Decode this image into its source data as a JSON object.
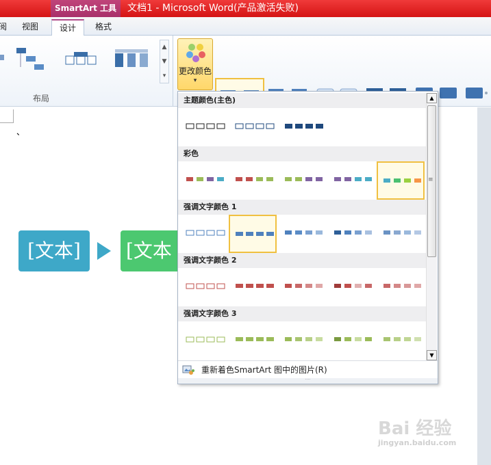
{
  "titlebar": {
    "tools_tab": "SmartArt 工具",
    "doc_title": "文档1 - Microsoft Word(产品激活失败)"
  },
  "tabs": [
    {
      "label": "阅"
    },
    {
      "label": "视图"
    },
    {
      "label": "设计"
    },
    {
      "label": "格式"
    }
  ],
  "ribbon": {
    "layout_group_label": "布局",
    "change_color_label": "更改颜色",
    "dropdown_arrow": "▾"
  },
  "dropdown": {
    "sections": [
      {
        "title": "主题颜色(主色)"
      },
      {
        "title": "彩色"
      },
      {
        "title": "强调文字颜色 1"
      },
      {
        "title": "强调文字颜色 2"
      },
      {
        "title": "强调文字颜色 3"
      }
    ],
    "recolor_label": "重新着色SmartArt 图中的图片(R)",
    "resize_grip": "····"
  },
  "document": {
    "box1_text": "[文本]",
    "box2_text": "[文本",
    "tick": "、"
  },
  "colors": {
    "accent1": "#4f81bd",
    "accent2": "#c0504d",
    "accent3": "#9bbb59",
    "accent4": "#8064a2",
    "accent5": "#4bacc6",
    "accent6": "#f79646",
    "dark": "#1f497d",
    "box1": "#3ea8c8",
    "box2": "#4cc870"
  },
  "watermark": {
    "text": "Bai 经验",
    "url": "jingyan.baidu.com"
  }
}
